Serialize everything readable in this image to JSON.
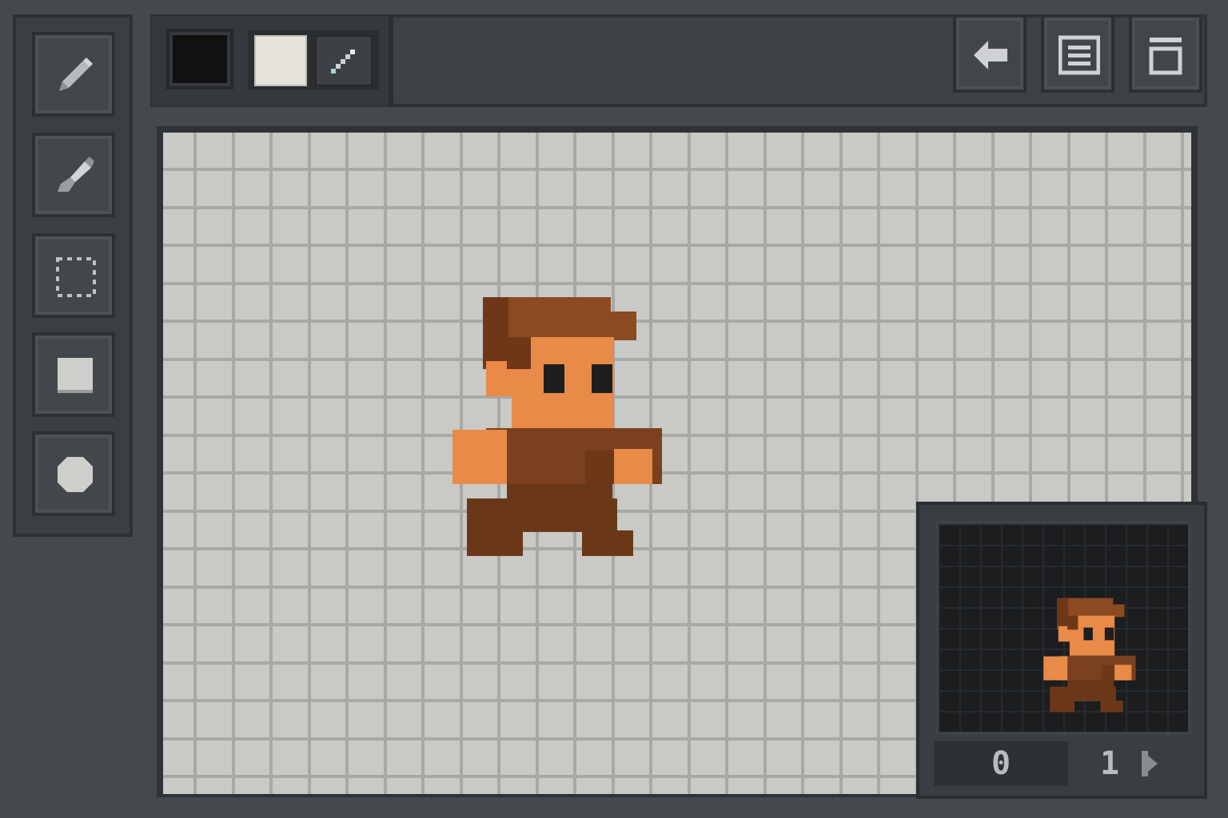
{
  "toolbar": {
    "tools": [
      {
        "name": "pencil-tool",
        "icon": "pencil-icon"
      },
      {
        "name": "brush-tool",
        "icon": "brush-icon"
      },
      {
        "name": "select-tool",
        "icon": "dashed-selection-icon"
      },
      {
        "name": "rectangle-tool",
        "icon": "filled-square-icon"
      },
      {
        "name": "circle-tool",
        "icon": "filled-circle-icon"
      }
    ]
  },
  "colors": {
    "primary": "#111111",
    "secondary": "#e6e3dc",
    "swap_icon": "swap-diagonal-icon"
  },
  "top_buttons": [
    {
      "name": "back-button",
      "icon": "arrow-left-icon"
    },
    {
      "name": "layers-button",
      "icon": "layers-list-icon"
    },
    {
      "name": "frame-button",
      "icon": "frame-window-icon"
    }
  ],
  "canvas": {
    "background": "#c9c9c5",
    "grid_color": "#a8a8a6"
  },
  "sprite_palette": {
    "hair": "#8a4a22",
    "hair_dark": "#6e3818",
    "skin": "#e88a48",
    "shirt": "#7a4020",
    "pants": "#6a3818",
    "eye": "#1e1e1e"
  },
  "preview": {
    "frame_current": "0",
    "frame_next": "1",
    "next_icon": "play-next-icon"
  }
}
